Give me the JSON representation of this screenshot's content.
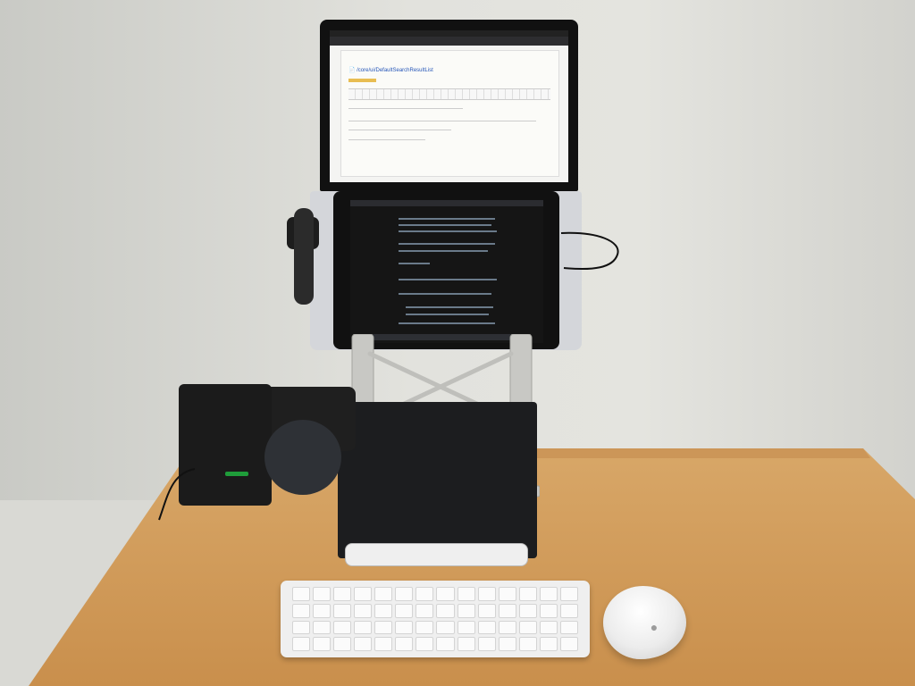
{
  "screen": {
    "laptop_title": "📄 /core/ui/DefaultSearchResultList"
  }
}
